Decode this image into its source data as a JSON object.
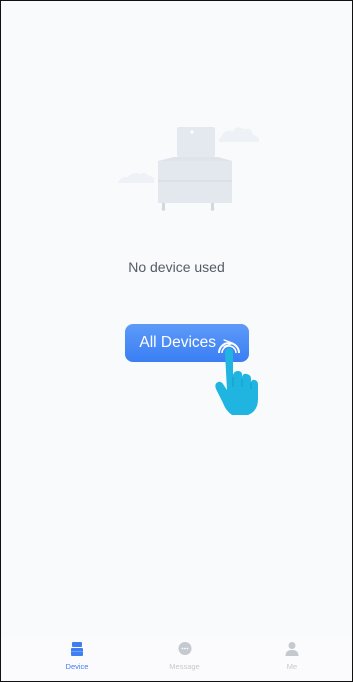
{
  "empty_state": {
    "message": "No device used",
    "button_label": "All Devices",
    "button_chevron": ">"
  },
  "tabbar": {
    "tabs": [
      {
        "id": "device",
        "label": "Device",
        "icon": "device-icon",
        "active": true
      },
      {
        "id": "message",
        "label": "Message",
        "icon": "message-icon",
        "active": false
      },
      {
        "id": "me",
        "label": "Me",
        "icon": "person-icon",
        "active": false
      }
    ]
  },
  "colors": {
    "accent": "#3f7ff2",
    "inactive": "#c4c8cf",
    "pointer_hand": "#1fb5e0"
  }
}
